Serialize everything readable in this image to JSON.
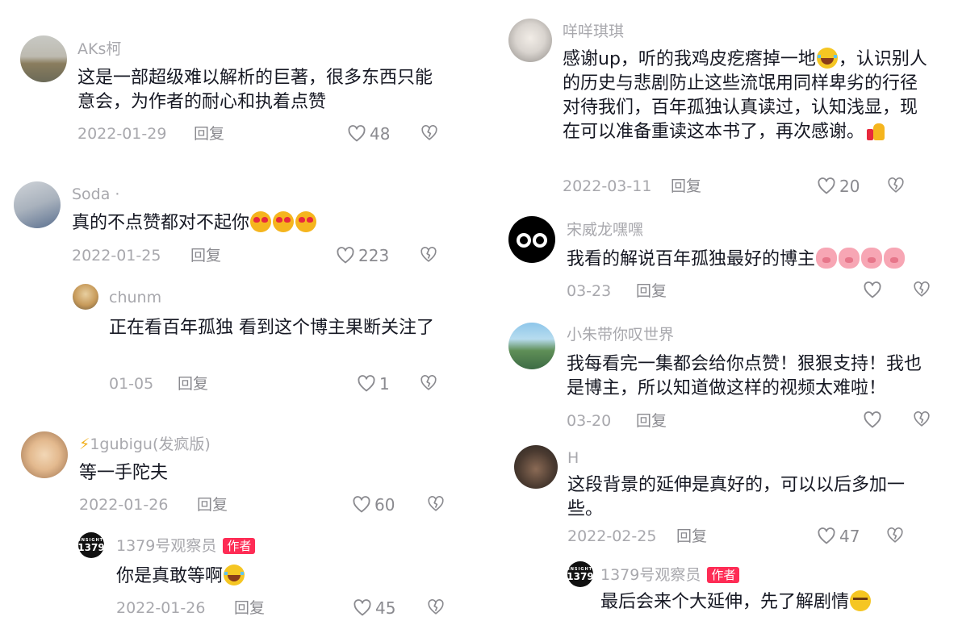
{
  "left_comments": [
    {
      "user": "AKs柯",
      "text": "这是一部超级难以解析的巨著，很多东西只能意会，为作者的耐心和执着点赞",
      "date": "2022-01-29",
      "reply": "回复",
      "likes": "48"
    },
    {
      "user": "Soda ·",
      "text": "真的不点赞都对不起你",
      "date": "2022-01-25",
      "reply": "回复",
      "likes": "223"
    },
    {
      "user": "chunm",
      "text": "正在看百年孤独 看到这个博主果断关注了",
      "date": "01-05",
      "reply": "回复",
      "likes": "1"
    },
    {
      "user": "1gubigu(发疯版)",
      "bolt": "⚡",
      "text": "等一手陀夫",
      "date": "2022-01-26",
      "reply": "回复",
      "likes": "60"
    },
    {
      "user": "1379号观察员",
      "tag": "作者",
      "text": "你是真敢等啊",
      "date": "2022-01-26",
      "reply": "回复",
      "likes": "45",
      "logo_small": "INSIGHT",
      "logo_big": "1379"
    }
  ],
  "right_comments": [
    {
      "user": "咩咩琪琪",
      "text_a": "感谢up，听的我鸡皮疙瘩掉一地",
      "text_b": "，认识别人的历史与悲剧防止这些流氓用同样卑劣的行径对待我们，百年孤独认真读过，认知浅显，现在可以准备重读这本书了，再次感谢。",
      "date": "2022-03-11",
      "reply": "回复",
      "likes": "20"
    },
    {
      "user": "宋威龙嘿嘿",
      "text": "我看的解说百年孤独最好的博主",
      "date": "03-23",
      "reply": "回复"
    },
    {
      "user": "小朱带你叹世界",
      "text": "我每看完一集都会给你点赞！狠狠支持！我也是博主，所以知道做这样的视频太难啦！",
      "date": "03-20",
      "reply": "回复"
    },
    {
      "user": "H",
      "text": "这段背景的延伸是真好的，可以以后多加一些。",
      "date": "2022-02-25",
      "reply": "回复",
      "likes": "47"
    },
    {
      "user": "1379号观察员",
      "tag": "作者",
      "text": "最后会来个大延伸，先了解剧情",
      "logo_small": "INSIGHT",
      "logo_big": "1379"
    }
  ],
  "colors": {
    "text": "#161823",
    "muted": "#a8a8ad",
    "author_tag": "#fe2c55"
  },
  "icons": {
    "like": "heart-outline-icon",
    "dislike": "broken-heart-icon"
  }
}
